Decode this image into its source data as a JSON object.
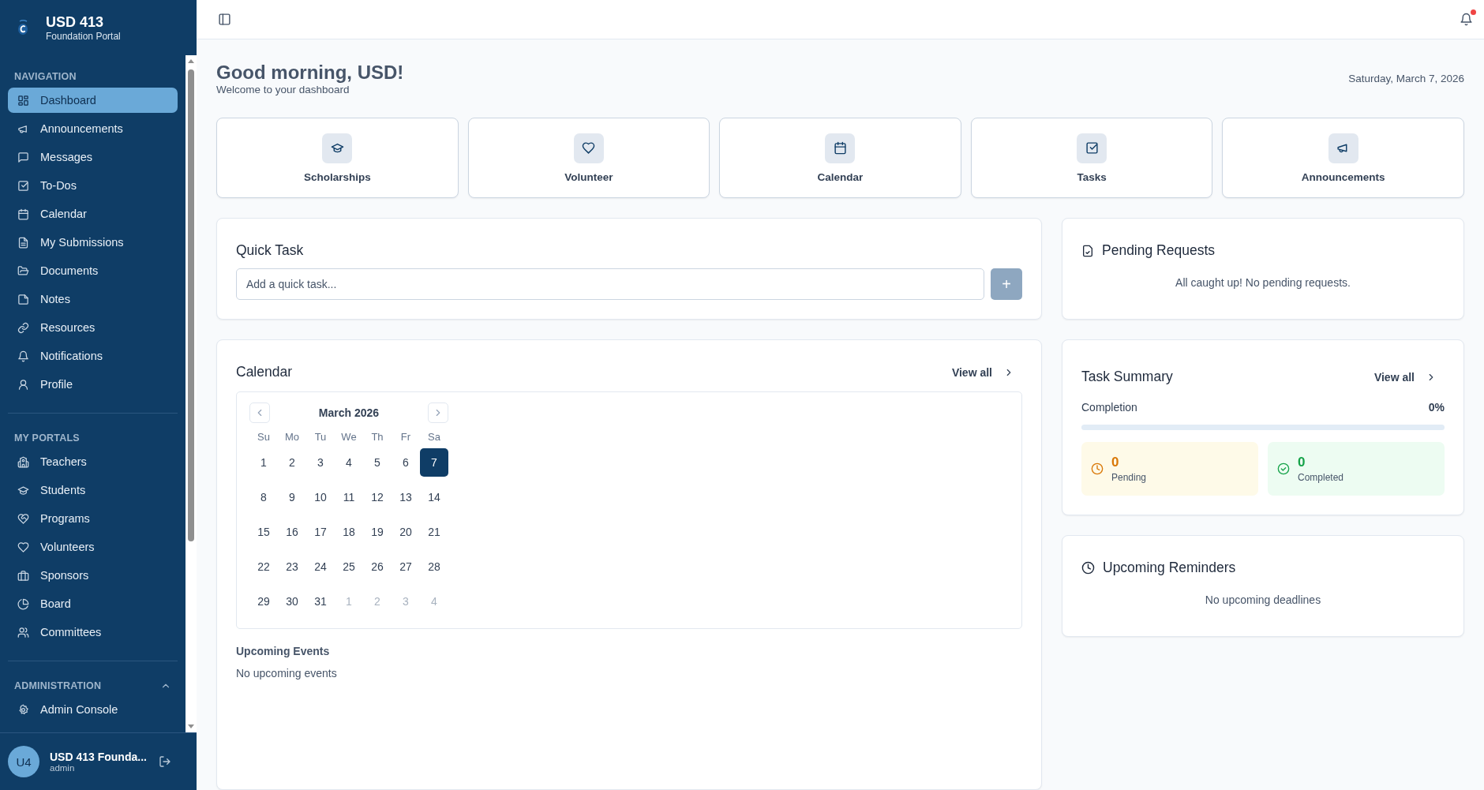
{
  "sidebar": {
    "brand": {
      "title": "USD 413",
      "subtitle": "Foundation Portal"
    },
    "sections": [
      {
        "heading": "NAVIGATION",
        "items": [
          {
            "label": "Dashboard",
            "selected": true
          },
          {
            "label": "Announcements",
            "selected": false
          },
          {
            "label": "Messages",
            "selected": false
          },
          {
            "label": "To-Dos",
            "selected": false
          },
          {
            "label": "Calendar",
            "selected": false
          },
          {
            "label": "My Submissions",
            "selected": false
          },
          {
            "label": "Documents",
            "selected": false
          },
          {
            "label": "Notes",
            "selected": false
          },
          {
            "label": "Resources",
            "selected": false
          },
          {
            "label": "Notifications",
            "selected": false
          },
          {
            "label": "Profile",
            "selected": false
          }
        ]
      },
      {
        "heading": "MY PORTALS",
        "items": [
          {
            "label": "Teachers",
            "selected": false
          },
          {
            "label": "Students",
            "selected": false
          },
          {
            "label": "Programs",
            "selected": false
          },
          {
            "label": "Volunteers",
            "selected": false
          },
          {
            "label": "Sponsors",
            "selected": false
          },
          {
            "label": "Board",
            "selected": false
          },
          {
            "label": "Committees",
            "selected": false
          }
        ]
      },
      {
        "heading": "ADMINISTRATION",
        "expanded": true,
        "items": [
          {
            "label": "Admin Console",
            "selected": false
          }
        ]
      }
    ],
    "user": {
      "initials": "U4",
      "name": "USD 413 Founda...",
      "role": "admin"
    }
  },
  "topbar": {
    "notifications_unread": true
  },
  "header": {
    "greeting": "Good morning, USD!",
    "subtitle": "Welcome to your dashboard",
    "date": "Saturday, March 7, 2026"
  },
  "shortcuts": [
    {
      "label": "Scholarships"
    },
    {
      "label": "Volunteer"
    },
    {
      "label": "Calendar"
    },
    {
      "label": "Tasks"
    },
    {
      "label": "Announcements"
    }
  ],
  "quick_task": {
    "title": "Quick Task",
    "placeholder": "Add a quick task...",
    "button": "+"
  },
  "calendar": {
    "title": "Calendar",
    "link": "View all",
    "month": "March 2026",
    "weekdays": [
      "Su",
      "Mo",
      "Tu",
      "We",
      "Th",
      "Fr",
      "Sa"
    ],
    "weeks": [
      [
        {
          "day": "1",
          "selected": false,
          "outside": false
        },
        {
          "day": "2",
          "selected": false,
          "outside": false
        },
        {
          "day": "3",
          "selected": false,
          "outside": false
        },
        {
          "day": "4",
          "selected": false,
          "outside": false
        },
        {
          "day": "5",
          "selected": false,
          "outside": false
        },
        {
          "day": "6",
          "selected": false,
          "outside": false
        },
        {
          "day": "7",
          "selected": true,
          "outside": false
        }
      ],
      [
        {
          "day": "8",
          "selected": false,
          "outside": false
        },
        {
          "day": "9",
          "selected": false,
          "outside": false
        },
        {
          "day": "10",
          "selected": false,
          "outside": false
        },
        {
          "day": "11",
          "selected": false,
          "outside": false
        },
        {
          "day": "12",
          "selected": false,
          "outside": false
        },
        {
          "day": "13",
          "selected": false,
          "outside": false
        },
        {
          "day": "14",
          "selected": false,
          "outside": false
        }
      ],
      [
        {
          "day": "15",
          "selected": false,
          "outside": false
        },
        {
          "day": "16",
          "selected": false,
          "outside": false
        },
        {
          "day": "17",
          "selected": false,
          "outside": false
        },
        {
          "day": "18",
          "selected": false,
          "outside": false
        },
        {
          "day": "19",
          "selected": false,
          "outside": false
        },
        {
          "day": "20",
          "selected": false,
          "outside": false
        },
        {
          "day": "21",
          "selected": false,
          "outside": false
        }
      ],
      [
        {
          "day": "22",
          "selected": false,
          "outside": false
        },
        {
          "day": "23",
          "selected": false,
          "outside": false
        },
        {
          "day": "24",
          "selected": false,
          "outside": false
        },
        {
          "day": "25",
          "selected": false,
          "outside": false
        },
        {
          "day": "26",
          "selected": false,
          "outside": false
        },
        {
          "day": "27",
          "selected": false,
          "outside": false
        },
        {
          "day": "28",
          "selected": false,
          "outside": false
        }
      ],
      [
        {
          "day": "29",
          "selected": false,
          "outside": false
        },
        {
          "day": "30",
          "selected": false,
          "outside": false
        },
        {
          "day": "31",
          "selected": false,
          "outside": false
        },
        {
          "day": "1",
          "selected": false,
          "outside": true
        },
        {
          "day": "2",
          "selected": false,
          "outside": true
        },
        {
          "day": "3",
          "selected": false,
          "outside": true
        },
        {
          "day": "4",
          "selected": false,
          "outside": true
        }
      ]
    ],
    "events_title": "Upcoming Events",
    "events_empty": "No upcoming events"
  },
  "pending_requests": {
    "title": "Pending Requests",
    "empty": "All caught up! No pending requests."
  },
  "task_summary": {
    "title": "Task Summary",
    "link": "View all",
    "completion_label": "Completion",
    "completion_value": "0%",
    "level": 0,
    "stats": [
      {
        "kind": "pending",
        "value": "0",
        "label": "Pending"
      },
      {
        "kind": "completed",
        "value": "0",
        "label": "Completed"
      }
    ]
  },
  "reminders": {
    "title": "Upcoming Reminders",
    "empty": "No upcoming deadlines"
  }
}
